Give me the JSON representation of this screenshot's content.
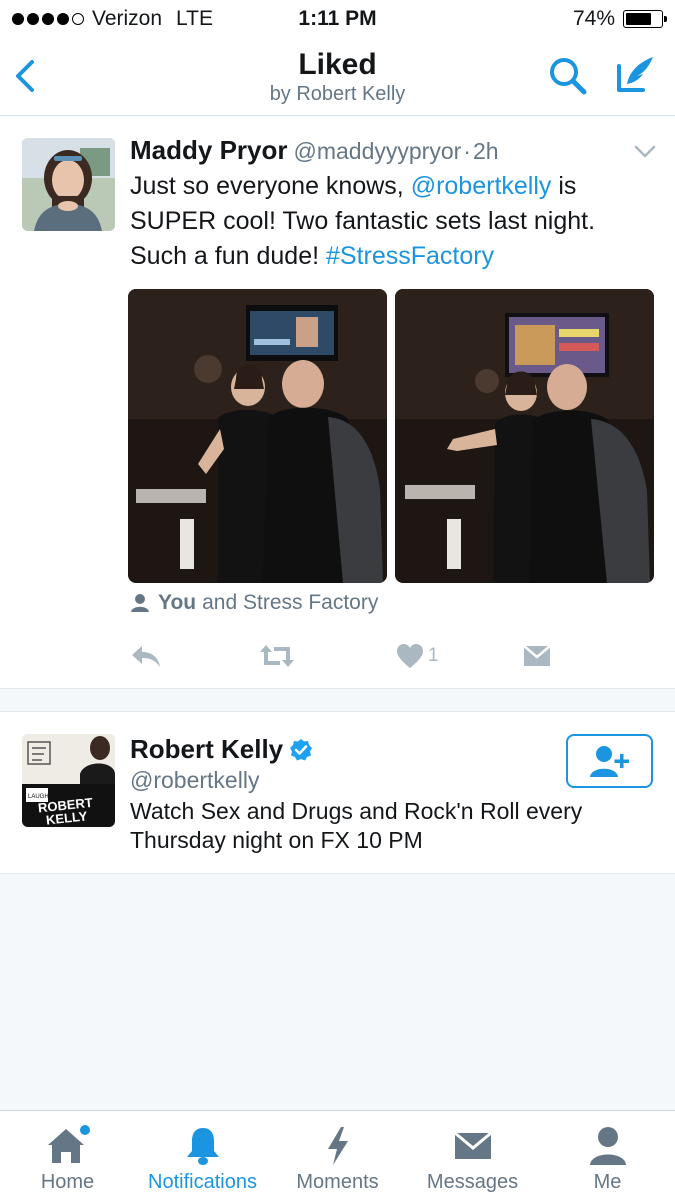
{
  "status_bar": {
    "carrier": "Verizon",
    "network": "LTE",
    "time": "1:11 PM",
    "battery": "74%",
    "battery_level": 0.74
  },
  "header": {
    "title": "Liked",
    "subtitle": "by Robert Kelly",
    "icons": [
      "back-chevron-icon",
      "search-icon",
      "compose-icon"
    ]
  },
  "tweet": {
    "name": "Maddy Pryor",
    "handle": "@maddyyypryor",
    "separator": "·",
    "time": "2h",
    "text_before": "Just so everyone knows, ",
    "mention": "@robertkelly",
    "text_middle": " is SUPER cool! Two fantastic sets last night. Such a fun dude! ",
    "hashtag": "#StressFactory",
    "likers_you": "You",
    "likers_rest": "and Stress Factory",
    "like_count": "1",
    "photo_count": 2
  },
  "suggested_user": {
    "name": "Robert Kelly",
    "verified": true,
    "handle": "@robertkelly",
    "bio": "Watch Sex and Drugs and Rock'n Roll every Thursday night on FX 10 PM"
  },
  "tabbar": {
    "items": [
      {
        "label": "Home",
        "icon": "home-icon",
        "badge": true
      },
      {
        "label": "Notifications",
        "icon": "bell-icon",
        "active": true
      },
      {
        "label": "Moments",
        "icon": "lightning-icon"
      },
      {
        "label": "Messages",
        "icon": "envelope-icon"
      },
      {
        "label": "Me",
        "icon": "person-icon"
      }
    ]
  },
  "colors": {
    "accent": "#1b95e0",
    "muted": "#657786",
    "action": "#aab8c2"
  }
}
